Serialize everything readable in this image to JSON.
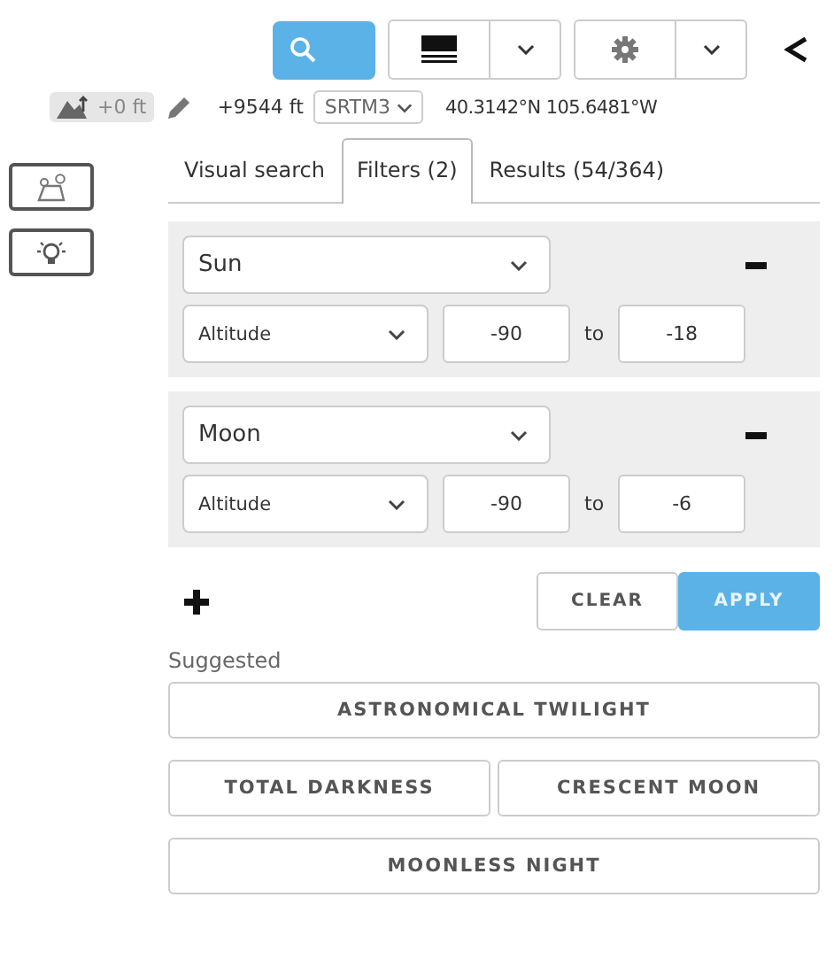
{
  "toolbar": {
    "buttons": [
      {
        "kind": "search",
        "selected": true
      },
      {
        "kind": "layers",
        "selected": false
      },
      {
        "kind": "settings",
        "selected": false
      }
    ]
  },
  "location": {
    "offset": "+0 ft",
    "elevation": "+9544 ft",
    "source": "SRTM3",
    "coordinates": "40.3142°N 105.6481°W"
  },
  "tabs": [
    {
      "label": "Visual search",
      "selected": false
    },
    {
      "label": "Filters (2)",
      "selected": true
    },
    {
      "label": "Results (54/364)",
      "selected": false
    }
  ],
  "filters": [
    {
      "body": "Sun",
      "property": "Altitude",
      "min": "-90",
      "to": "to",
      "max": "-18"
    },
    {
      "body": "Moon",
      "property": "Altitude",
      "min": "-90",
      "to": "to",
      "max": "-6"
    }
  ],
  "actions": [
    {
      "label": "CLEAR",
      "kind": "secondary"
    },
    {
      "label": "APPLY",
      "kind": "primary"
    }
  ],
  "suggested": {
    "label": "Suggested",
    "rows": [
      [
        "ASTRONOMICAL TWILIGHT"
      ],
      [
        "TOTAL DARKNESS",
        "CRESCENT MOON"
      ],
      [
        "MOONLESS NIGHT"
      ]
    ]
  }
}
